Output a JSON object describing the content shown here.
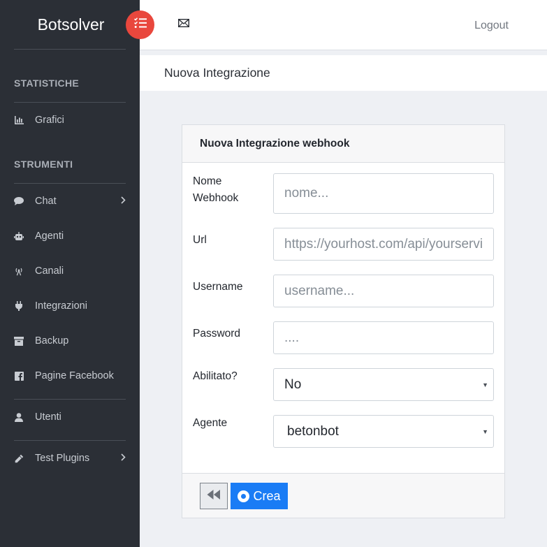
{
  "brand": "Botsolver",
  "topbar": {
    "logout_label": "Logout"
  },
  "sidebar": {
    "sections": [
      {
        "heading": "STATISTICHE",
        "items": [
          {
            "label": "Grafici",
            "icon": "chart-icon"
          }
        ]
      },
      {
        "heading": "STRUMENTI",
        "items": [
          {
            "label": "Chat",
            "icon": "chat-icon",
            "has_submenu": true
          },
          {
            "label": "Agenti",
            "icon": "robot-icon"
          },
          {
            "label": "Canali",
            "icon": "broadcast-icon"
          },
          {
            "label": "Integrazioni",
            "icon": "plug-icon"
          },
          {
            "label": "Backup",
            "icon": "archive-icon"
          },
          {
            "label": "Pagine Facebook",
            "icon": "facebook-icon"
          }
        ]
      },
      {
        "items": [
          {
            "label": "Utenti",
            "icon": "user-icon"
          }
        ]
      },
      {
        "items": [
          {
            "label": "Test Plugins",
            "icon": "eyedropper-icon",
            "has_submenu": true
          }
        ]
      }
    ]
  },
  "page_title": "Nuova Integrazione",
  "form": {
    "title": "Nuova Integrazione webhook",
    "fields": {
      "name": {
        "label": "Nome Webhook",
        "placeholder": "nome...",
        "value": ""
      },
      "url": {
        "label": "Url",
        "placeholder": "https://yourhost.com/api/yourservice",
        "value": ""
      },
      "username": {
        "label": "Username",
        "placeholder": "username...",
        "value": ""
      },
      "password": {
        "label": "Password",
        "placeholder": "....",
        "value": ""
      },
      "enabled": {
        "label": "Abilitato?",
        "selected": "No"
      },
      "agent": {
        "label": "Agente",
        "selected": "betonbot"
      }
    },
    "create_label": "Crea"
  },
  "colors": {
    "sidebar_bg": "#2b2f36",
    "accent_red": "#e9473d",
    "primary_blue": "#1a7cf5",
    "page_bg": "#eef0f4"
  }
}
